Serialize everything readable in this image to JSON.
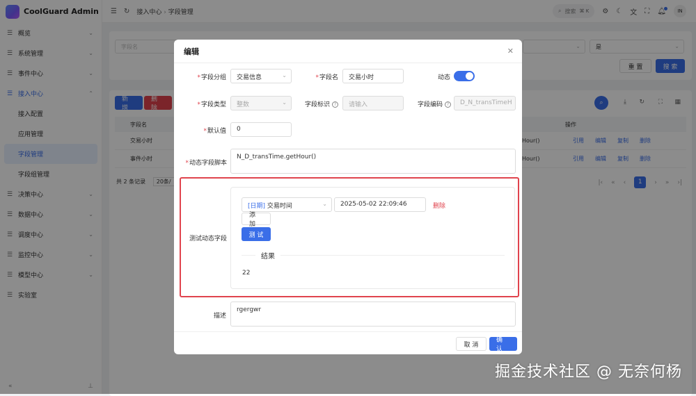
{
  "app": {
    "title": "CoolGuard Admin"
  },
  "sidebar": {
    "items": [
      {
        "label": "概览"
      },
      {
        "label": "系统管理"
      },
      {
        "label": "事件中心"
      },
      {
        "label": "接入中心"
      },
      {
        "label": "决策中心"
      },
      {
        "label": "数据中心"
      },
      {
        "label": "调度中心"
      },
      {
        "label": "监控中心"
      },
      {
        "label": "模型中心"
      },
      {
        "label": "实验室"
      }
    ],
    "subitems": [
      {
        "label": "接入配置"
      },
      {
        "label": "应用管理"
      },
      {
        "label": "字段管理"
      },
      {
        "label": "字段组管理"
      }
    ]
  },
  "topbar": {
    "breadcrumb": [
      "接入中心",
      "字段管理"
    ],
    "search_label": "搜索",
    "shortcut": "⌘ K",
    "avatar": "IN"
  },
  "filter": {
    "field_name_placeholder": "字段名",
    "select_value": "是",
    "reset_label": "重 置",
    "search_label": "搜 索"
  },
  "table": {
    "add_label": "新 增",
    "delete_label": "删 除",
    "columns": {
      "name": "字段名",
      "ops": "操作"
    },
    "rows": [
      {
        "name": "交易小时",
        "script": "Hour()",
        "ref": "引用",
        "edit": "编辑",
        "copy": "复制",
        "del": "删除"
      },
      {
        "name": "事件小时",
        "script": "Hour()",
        "ref": "引用",
        "edit": "编辑",
        "copy": "复制",
        "del": "删除"
      }
    ],
    "total": "共 2 条记录",
    "page_size": "20条/",
    "current_page": "1"
  },
  "modal": {
    "title": "编辑",
    "field_group_label": "字段分组",
    "field_group_value": "交易信息",
    "field_name_label": "字段名",
    "field_name_value": "交易小时",
    "dynamic_label": "动态",
    "dynamic_on": true,
    "field_type_label": "字段类型",
    "field_type_value": "整数",
    "field_id_label": "字段标识",
    "field_id_placeholder": "请输入",
    "field_code_label": "字段编码",
    "field_code_value": "D_N_transTimeH",
    "default_label": "默认值",
    "default_value": "0",
    "script_label": "动态字段脚本",
    "script_value": "N_D_transTime.getHour()",
    "test_label": "测试动态字段",
    "test_field_tag": "[日期]",
    "test_field_name": "交易时间",
    "test_datetime": "2025-05-02 22:09:46",
    "test_delete": "删除",
    "add_label": "添 加",
    "test_button": "测 试",
    "result_label": "结果",
    "result_value": "22",
    "desc_label": "描述",
    "desc_value": "rgergwr",
    "cancel_label": "取 消",
    "confirm_label": "确 认"
  },
  "watermark": "掘金技术社区 @ 无奈何杨",
  "colors": {
    "primary": "#3a6ee8",
    "danger": "#e0434d"
  }
}
